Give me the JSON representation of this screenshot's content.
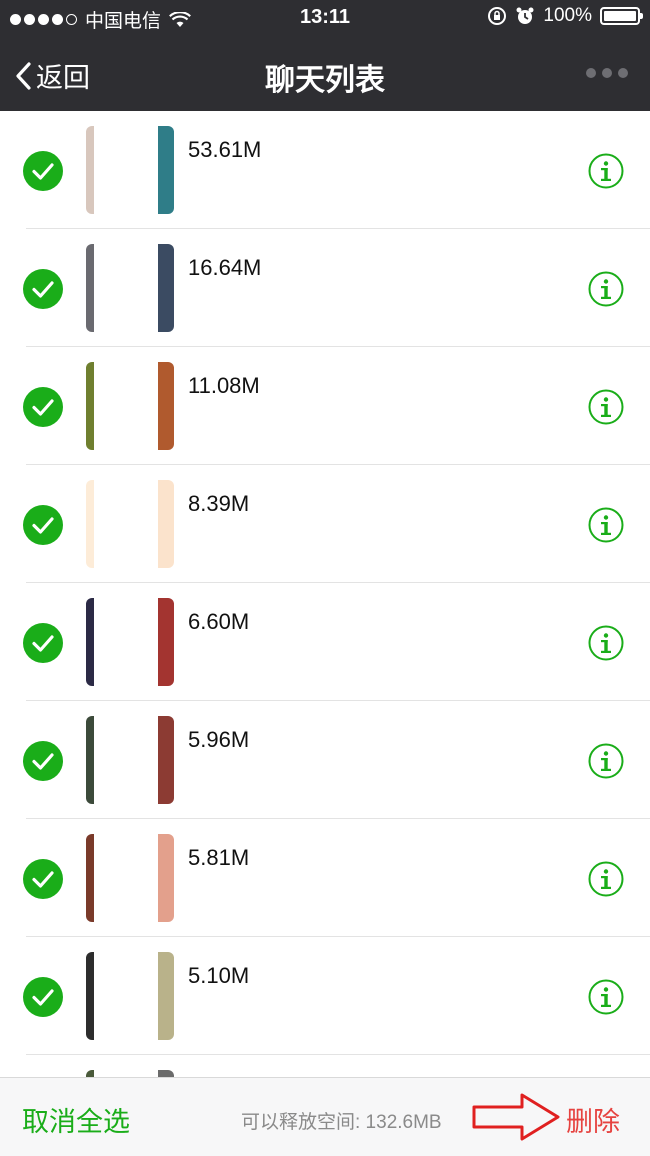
{
  "status_bar": {
    "carrier": "中国电信",
    "time": "13:11",
    "battery": "100%"
  },
  "nav": {
    "back_label": "返回",
    "title": "聊天列表"
  },
  "items": [
    {
      "size": "53.61M",
      "checked": true,
      "thumb_colors": [
        "#d8c7bd",
        "#2f7d88"
      ]
    },
    {
      "size": "16.64M",
      "checked": true,
      "thumb_colors": [
        "#6a6a70",
        "#3b4b62"
      ]
    },
    {
      "size": "11.08M",
      "checked": true,
      "thumb_colors": [
        "#6f7f2f",
        "#b05a2e"
      ]
    },
    {
      "size": "8.39M",
      "checked": true,
      "thumb_colors": [
        "#fdecd8",
        "#fbe3cc"
      ]
    },
    {
      "size": "6.60M",
      "checked": true,
      "thumb_colors": [
        "#2b2a45",
        "#a33430"
      ]
    },
    {
      "size": "5.96M",
      "checked": true,
      "thumb_colors": [
        "#3c4a3a",
        "#8c3b33"
      ]
    },
    {
      "size": "5.81M",
      "checked": true,
      "thumb_colors": [
        "#7a3a2a",
        "#e3a08c"
      ]
    },
    {
      "size": "5.10M",
      "checked": true,
      "thumb_colors": [
        "#2d2d2d",
        "#b9b28a"
      ]
    },
    {
      "size": "",
      "checked": true,
      "thumb_colors": [
        "#4a5a3a",
        "#6b6b6b"
      ]
    }
  ],
  "bottom_bar": {
    "cancel_all_label": "取消全选",
    "free_space_text": "可以释放空间: 132.6MB",
    "delete_label": "删除"
  },
  "colors": {
    "accent_green": "#1aad19",
    "delete_red": "#e64340",
    "header_bg": "#2e2e32"
  },
  "icons": {
    "check": "check-circle-icon",
    "info": "info-circle-icon",
    "back": "chevron-left-icon",
    "more": "more-dots-icon",
    "annotation": "red-arrow-icon"
  }
}
